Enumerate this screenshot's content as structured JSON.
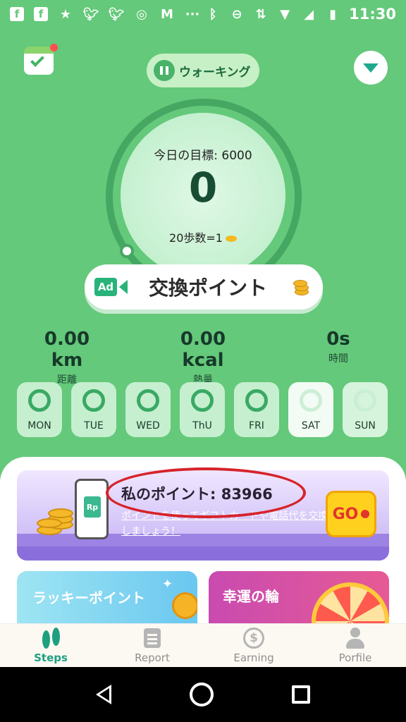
{
  "status_bar": {
    "time": "11:30",
    "left_icons": [
      "facebook-icon",
      "facebook-icon",
      "star-icon",
      "twitter-icon",
      "twitter-icon",
      "instagram-icon",
      "gmail-icon",
      "more-icon"
    ],
    "right_icons": [
      "bluetooth-icon",
      "do-not-disturb-icon",
      "data-arrows-icon",
      "wifi-icon",
      "signal-icon",
      "battery-icon"
    ]
  },
  "header": {
    "mode_label": "ウォーキング"
  },
  "ring": {
    "goal_label": "今日の目標: 6000",
    "steps": "0",
    "rate_label": "20歩数=1",
    "progress_fraction": 0
  },
  "exchange": {
    "ad_label": "Ad",
    "label": "交換ポイント"
  },
  "stats": [
    {
      "value": "0.00 km",
      "label": "距離"
    },
    {
      "value": "0.00 kcal",
      "label": "熱量"
    },
    {
      "value": "0s",
      "label": "時間"
    }
  ],
  "days": [
    {
      "label": "MON",
      "state": "past"
    },
    {
      "label": "TUE",
      "state": "past"
    },
    {
      "label": "WED",
      "state": "past"
    },
    {
      "label": "ThU",
      "state": "past"
    },
    {
      "label": "FRI",
      "state": "past"
    },
    {
      "label": "SAT",
      "state": "today"
    },
    {
      "label": "SUN",
      "state": "future"
    }
  ],
  "points_card": {
    "title": "私のポイント: 83966",
    "subtitle": "ポイントを使ってギフトカードや電話代を交換しましょう！",
    "phone_label": "Rp",
    "go_label": "GO"
  },
  "cards": {
    "lucky_label": "ラッキーポイント",
    "wheel_label": "幸運の輪"
  },
  "bottom_nav": [
    {
      "label": "Steps",
      "icon": "footsteps-icon",
      "active": true
    },
    {
      "label": "Report",
      "icon": "clipboard-icon",
      "active": false
    },
    {
      "label": "Earning",
      "icon": "dollar-icon",
      "active": false
    },
    {
      "label": "Porfile",
      "icon": "person-icon",
      "active": false
    }
  ],
  "colors": {
    "background": "#64c97a",
    "accent": "#1ea080",
    "highlight": "#d6232a",
    "go_button": "#ffd11e"
  }
}
